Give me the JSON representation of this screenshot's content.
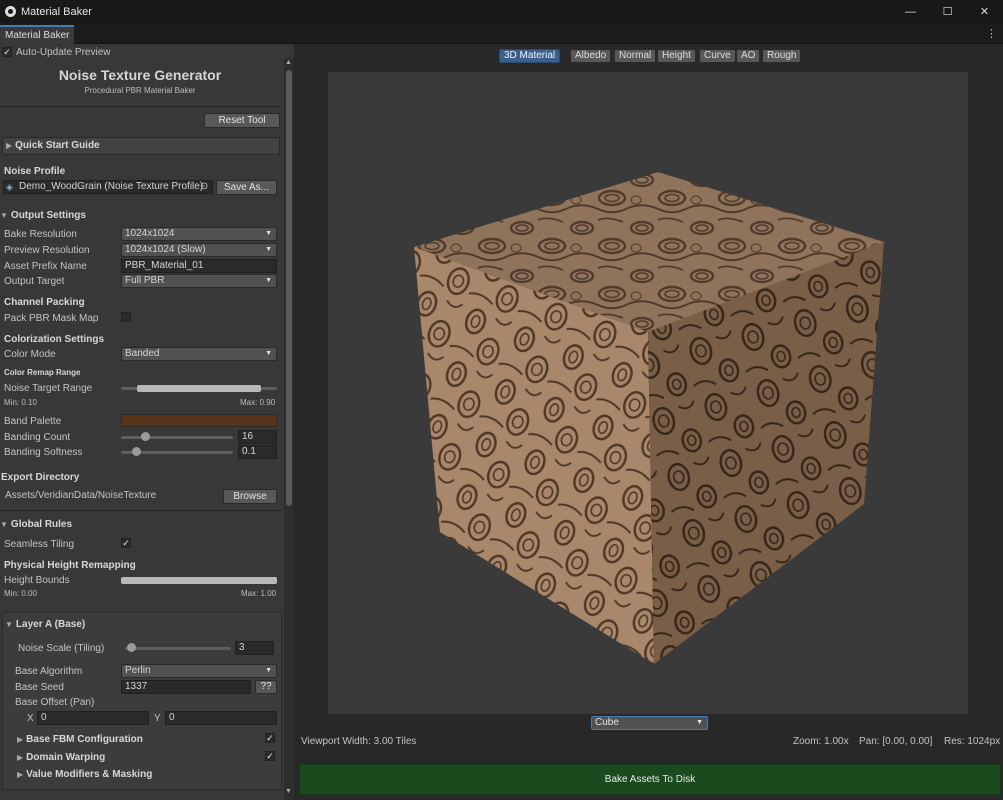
{
  "window": {
    "title": "Material Baker",
    "icon": "unity-logo-icon"
  },
  "tab": {
    "label": "Material Baker"
  },
  "panel": {
    "auto_update": {
      "label": "Auto-Update Preview",
      "checked": true
    },
    "header": {
      "title": "Noise Texture Generator",
      "subtitle": "Procedural PBR Material Baker"
    },
    "reset_button": "Reset Tool",
    "quick_start": "Quick Start Guide",
    "noise_profile": {
      "heading": "Noise Profile",
      "value": "Demo_WoodGrain (Noise Texture Profile)",
      "save_as": "Save As..."
    },
    "output_settings": {
      "heading": "Output Settings",
      "bake_resolution": {
        "label": "Bake Resolution",
        "value": "1024x1024"
      },
      "preview_resolution": {
        "label": "Preview Resolution",
        "value": "1024x1024 (Slow)"
      },
      "asset_prefix": {
        "label": "Asset Prefix Name",
        "value": "PBR_Material_01"
      },
      "output_target": {
        "label": "Output Target",
        "value": "Full PBR"
      }
    },
    "channel_packing": {
      "heading": "Channel Packing",
      "pack_mask": {
        "label": "Pack PBR Mask Map",
        "checked": false
      }
    },
    "colorization": {
      "heading": "Colorization Settings",
      "color_mode": {
        "label": "Color Mode",
        "value": "Banded"
      },
      "remap_heading": "Color Remap Range",
      "target_range": {
        "label": "Noise Target Range",
        "min_label": "Min: 0.10",
        "max_label": "Max: 0.90",
        "min": 0.1,
        "max": 0.9
      },
      "band_palette": {
        "label": "Band Palette",
        "color": "#5a3418"
      },
      "banding_count": {
        "label": "Banding Count",
        "value": "16",
        "fraction": 0.18
      },
      "banding_softness": {
        "label": "Banding Softness",
        "value": "0.1",
        "fraction": 0.1
      }
    },
    "export": {
      "heading": "Export Directory",
      "path": "Assets/VeridianData/NoiseTexture",
      "browse": "Browse"
    },
    "global_rules": {
      "heading": "Global Rules",
      "seamless": {
        "label": "Seamless Tiling",
        "checked": true
      },
      "phys_heading": "Physical Height Remapping",
      "height_bounds": {
        "label": "Height Bounds",
        "min_label": "Min: 0.00",
        "max_label": "Max: 1.00",
        "min": 0.0,
        "max": 1.0
      }
    },
    "layer_a": {
      "heading": "Layer A (Base)",
      "noise_scale": {
        "label": "Noise Scale (Tiling)",
        "value": "3",
        "fraction": 0.02
      },
      "base_algorithm": {
        "label": "Base Algorithm",
        "value": "Perlin"
      },
      "base_seed": {
        "label": "Base Seed",
        "value": "1337",
        "random": "??"
      },
      "base_offset": {
        "label": "Base Offset (Pan)",
        "x_label": "X",
        "x": "0",
        "y_label": "Y",
        "y": "0"
      },
      "fbm": {
        "label": "Base FBM Configuration",
        "checked": true
      },
      "warping": {
        "label": "Domain Warping",
        "checked": true
      },
      "modifiers": {
        "label": "Value Modifiers & Masking"
      }
    }
  },
  "preview": {
    "channels": [
      "3D Material",
      "Albedo",
      "Normal",
      "Height",
      "Curve",
      "AO",
      "Rough"
    ],
    "active_channel": "3D Material",
    "shape": "Cube",
    "status": {
      "viewport_width": "Viewport Width: 3.00 Tiles",
      "zoom": "Zoom: 1.00x",
      "pan": "Pan: [0.00, 0.00]",
      "res": "Res: 1024px"
    },
    "bake_button": "Bake Assets To Disk",
    "colors": {
      "wood_light": "#a8876a",
      "wood_dark": "#4a3424",
      "bake_green": "#1b4a1f",
      "accent": "#3c5f8a"
    }
  }
}
